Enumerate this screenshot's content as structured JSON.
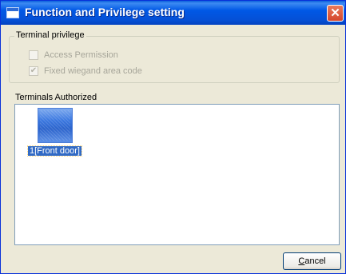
{
  "window": {
    "title": "Function and Privilege setting",
    "close_glyph": "✕"
  },
  "terminal_privilege": {
    "legend": "Terminal privilege",
    "options": [
      {
        "label": "Access Permission",
        "checked": false,
        "enabled": false
      },
      {
        "label": "Fixed wiegand area code",
        "checked": true,
        "enabled": false
      }
    ]
  },
  "terminals": {
    "label": "Terminals Authorized",
    "items": [
      {
        "label": "1[Front door]",
        "icon": "terminal-icon",
        "selected": true
      }
    ]
  },
  "buttons": {
    "cancel_accel": "C",
    "cancel_rest": "ancel"
  },
  "colors": {
    "titlebar": "#0058E6",
    "selection": "#316AC5",
    "dialog_bg": "#ECE9D8"
  }
}
